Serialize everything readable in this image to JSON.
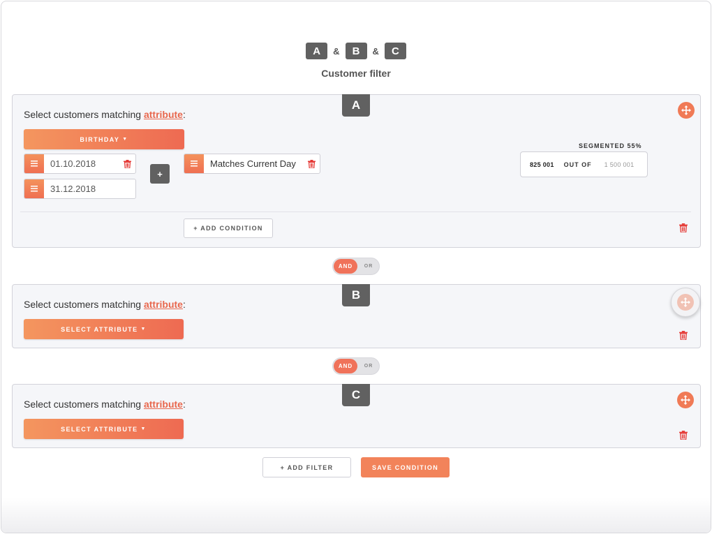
{
  "header": {
    "chips": [
      "A",
      "B",
      "C"
    ],
    "separator": "&",
    "title": "Customer filter"
  },
  "panels": [
    {
      "label": "A",
      "heading_prefix": "Select customers matching",
      "heading_link": "attribute",
      "heading_suffix": ":",
      "attribute_button": "BIRTHDAY",
      "dates": [
        "01.10.2018",
        "31.12.2018"
      ],
      "add_date_label": "+",
      "match_value": "Matches Current Day",
      "segmented": {
        "label": "SEGMENTED 55%",
        "count": "825 001",
        "out_of": "OUT OF",
        "total": "1 500 001",
        "percent": 0.55
      },
      "add_condition": "+ ADD CONDITION"
    },
    {
      "label": "B",
      "heading_prefix": "Select customers matching",
      "heading_link": "attribute",
      "heading_suffix": ":",
      "attribute_button": "SELECT ATTRIBUTE"
    },
    {
      "label": "C",
      "heading_prefix": "Select customers matching",
      "heading_link": "attribute",
      "heading_suffix": ":",
      "attribute_button": "SELECT ATTRIBUTE"
    }
  ],
  "toggles": [
    {
      "on": "AND",
      "off": "OR"
    },
    {
      "on": "AND",
      "off": "OR"
    }
  ],
  "footer": {
    "add_filter": "+ ADD FILTER",
    "save_condition": "SAVE CONDITION"
  },
  "colors": {
    "accent": "#f07a56",
    "dark_chip": "#616161",
    "panel_bg": "#f5f6f9",
    "delete_red": "#e53935"
  },
  "icons": {
    "move": "move-icon",
    "delete": "trash-icon",
    "calendar": "calendar-icon",
    "caret": "caret-down-icon"
  }
}
